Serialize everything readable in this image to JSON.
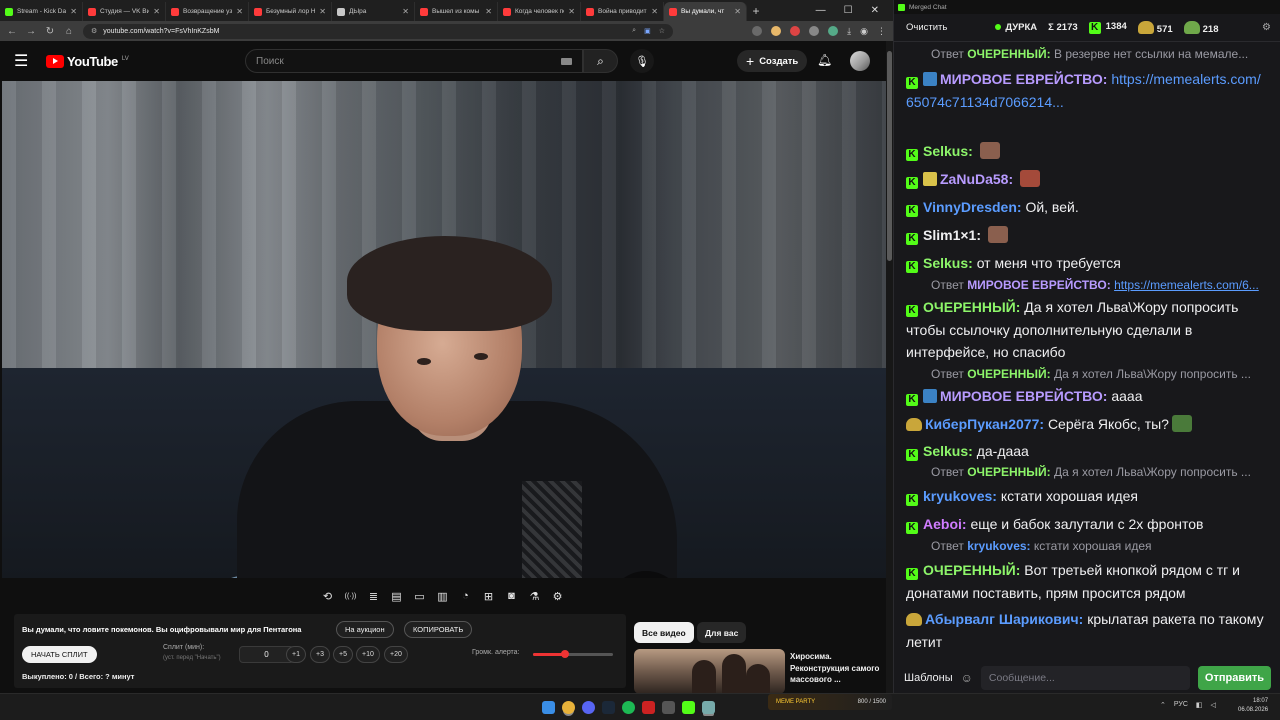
{
  "browser": {
    "tabs": [
      {
        "title": "Stream - Kick Dash",
        "color": "#53fc18"
      },
      {
        "title": "Студия — VK Видео",
        "color": "#ff3b3b"
      },
      {
        "title": "Возвращение уз",
        "color": "#ff3b3b"
      },
      {
        "title": "Безумный лор Ни",
        "color": "#ff3b3b"
      },
      {
        "title": "ДЫра",
        "color": "#c8c8c8"
      },
      {
        "title": "Вышел из комы в",
        "color": "#ff3b3b"
      },
      {
        "title": "Когда человек по",
        "color": "#ff3b3b"
      },
      {
        "title": "Война приводит",
        "color": "#ff3b3b"
      },
      {
        "title": "Вы думали, чт",
        "color": "#ff3b3b"
      }
    ],
    "active_tab_index": 8,
    "new_tab": "+",
    "window_controls": {
      "minimize": "—",
      "maximize": "☐",
      "close": "✕"
    },
    "url": "youtube.com/watch?v=FsVhInKZsbM"
  },
  "youtube": {
    "logo_text": "YouTube",
    "country_code": "LV",
    "search_placeholder": "Поиск",
    "create_label": "Создать",
    "player_tools": [
      "loop-icon",
      "broadcast-icon",
      "playlist-icon",
      "clapper-icon",
      "pip-icon",
      "subtitles-icon",
      "speed-icon",
      "add-icon",
      "screenshot-icon",
      "flask-icon",
      "settings-icon"
    ],
    "panel": {
      "title": "Вы думали, что ловите покемонов. Вы оцифровывали мир для Пентагона",
      "auction_button": "На аукцион",
      "copy_button": "КОПИРОВАТЬ",
      "start_split_button": "НАЧАТЬ СПЛИТ",
      "split_label": "Сплит (мин):",
      "split_sublabel": "(уст. перед \"Начать\")",
      "split_value": "0",
      "increments": [
        "+1",
        "+3",
        "+5",
        "+10",
        "+20"
      ],
      "volume_label": "Громк. алерта:",
      "volume_level": 0.4,
      "bought_text": "Выкуплено: 0 / Всего: ? минут"
    },
    "chips": [
      "Все видео",
      "Для вас"
    ],
    "recommendation": {
      "title": "Хиросима. Реконструкция самого массового ..."
    }
  },
  "chat": {
    "window_title": "Merged Chat",
    "clear_button": "Очистить",
    "channel": "ДУРКА",
    "stats": [
      {
        "icon": "Σ",
        "value": "2173"
      },
      {
        "icon": "kick",
        "value": "1384"
      },
      {
        "icon": "twitch",
        "value": "571"
      },
      {
        "icon": "vk",
        "value": "218"
      }
    ],
    "messages": [
      {
        "type": "reply",
        "prefix": "Ответ",
        "nick": "ОЧЕРЕННЫЙ:",
        "nick_color": "#8df56a",
        "text": "В резерве нет ссылки на мемале..."
      },
      {
        "type": "msg",
        "platform": "kick",
        "badge": "#3b82c4",
        "nick": "МИРОВОЕ ЕВРЕЙСТВО:",
        "nick_color": "#b89bff",
        "text": "",
        "link": "https://memealerts.com/65074c71134d7066214..."
      },
      {
        "type": "msg",
        "platform": "kick",
        "nick": "Selkus:",
        "nick_color": "#8df56a",
        "text": "",
        "emote": "#8a5f4e"
      },
      {
        "type": "msg",
        "platform": "kick",
        "badge": "#d9c24a",
        "nick": "ZaNuDa58:",
        "nick_color": "#b89bff",
        "text": "",
        "emote": "#a44a3a"
      },
      {
        "type": "msg",
        "platform": "kick",
        "nick": "VinnyDresden:",
        "nick_color": "#5b9cff",
        "text": "Ой, вей."
      },
      {
        "type": "msg",
        "platform": "kick",
        "nick": "Slim1×1:",
        "nick_color": "#efeff1",
        "text": "",
        "emote": "#8a5f4e"
      },
      {
        "type": "msg",
        "platform": "kick",
        "nick": "Selkus:",
        "nick_color": "#8df56a",
        "text": "от меня что требуется"
      },
      {
        "type": "reply",
        "prefix": "Ответ",
        "nick": "МИРОВОЕ ЕВРЕЙСТВО:",
        "nick_color": "#b89bff",
        "text": "https://memealerts.com/6..."
      },
      {
        "type": "msg",
        "platform": "kick",
        "nick": "ОЧЕРЕННЫЙ:",
        "nick_color": "#8df56a",
        "text": "Да я хотел Льва\\Жору попросить чтобы ссылочку дополнительную сделали в интерфейсе, но спасибо"
      },
      {
        "type": "reply",
        "prefix": "Ответ",
        "nick": "ОЧЕРЕННЫЙ:",
        "nick_color": "#8df56a",
        "text": "Да я хотел Льва\\Жору попросить ..."
      },
      {
        "type": "msg",
        "platform": "kick",
        "badge": "#3b82c4",
        "nick": "МИРОВОЕ ЕВРЕЙСТВО:",
        "nick_color": "#b89bff",
        "text": "аааа"
      },
      {
        "type": "msg",
        "platform": "twitch",
        "nick": "КиберПукан2077:",
        "nick_color": "#5b9cff",
        "text": "Серёга Якобс, ты?",
        "emote": "#4a7a3a"
      },
      {
        "type": "msg",
        "platform": "kick",
        "nick": "Selkus:",
        "nick_color": "#8df56a",
        "text": "да-дааа"
      },
      {
        "type": "reply",
        "prefix": "Ответ",
        "nick": "ОЧЕРЕННЫЙ:",
        "nick_color": "#8df56a",
        "text": "Да я хотел Льва\\Жору попросить ..."
      },
      {
        "type": "msg",
        "platform": "kick",
        "nick": "kryukoves:",
        "nick_color": "#5b9cff",
        "text": "кстати хорошая идея"
      },
      {
        "type": "msg",
        "platform": "kick",
        "nick": "Aeboi:",
        "nick_color": "#d07cff",
        "text": "еще и бабок залутали с 2х фронтов"
      },
      {
        "type": "reply",
        "prefix": "Ответ",
        "nick": "kryukoves:",
        "nick_color": "#5b9cff",
        "text": "кстати хорошая идея"
      },
      {
        "type": "msg",
        "platform": "kick",
        "nick": "ОЧЕРЕННЫЙ:",
        "nick_color": "#8df56a",
        "text": "Вот третьей кнопкой рядом с тг и донатами поставить, прям просится рядом"
      },
      {
        "type": "msg",
        "platform": "twitch",
        "nick": "Абырвалг Шарикович:",
        "nick_color": "#5b9cff",
        "text": "крылатая ракета по такому летит"
      }
    ],
    "templates_button": "Шаблоны",
    "input_placeholder": "Сообщение...",
    "send_button": "Отправить"
  },
  "taskbar": {
    "meme_party": "MEME PARTY",
    "meme_count": "800 / 1500",
    "language": "РУС",
    "time": "18:07",
    "date": "06.08.2026"
  }
}
